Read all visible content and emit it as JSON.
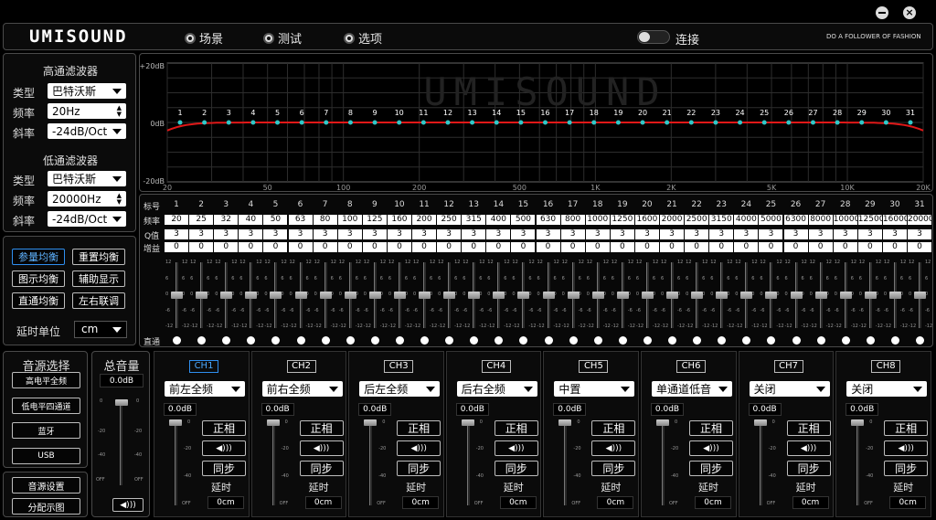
{
  "app": {
    "logo": "UMISOUND",
    "tagline": "DO A FOLLOWER OF FASHION",
    "connect": "连接"
  },
  "menu": [
    "场景",
    "测试",
    "选项"
  ],
  "hpf": {
    "title": "高通滤波器",
    "type_label": "类型",
    "type": "巴特沃斯",
    "freq_label": "频率",
    "freq": "20Hz",
    "slope_label": "斜率",
    "slope": "-24dB/Oct"
  },
  "lpf": {
    "title": "低通滤波器",
    "type_label": "类型",
    "type": "巴特沃斯",
    "freq_label": "频率",
    "freq": "20000Hz",
    "slope_label": "斜率",
    "slope": "-24dB/Oct"
  },
  "eq_buttons": [
    "参量均衡",
    "重置均衡",
    "图示均衡",
    "辅助显示",
    "直通均衡",
    "左右联调"
  ],
  "delay_unit": {
    "label": "延时单位",
    "value": "cm"
  },
  "graph": {
    "y_labels": [
      "+20dB",
      "0dB",
      "-20dB"
    ],
    "x_labels": [
      "20",
      "50",
      "100",
      "200",
      "500",
      "1K",
      "2K",
      "5K",
      "10K",
      "20K"
    ],
    "watermark": "UMISOUND"
  },
  "eq_table": {
    "row_labels": [
      "标号",
      "频率",
      "Q值",
      "增益"
    ],
    "freqs": [
      "20",
      "25",
      "32",
      "40",
      "50",
      "63",
      "80",
      "100",
      "125",
      "160",
      "200",
      "250",
      "315",
      "400",
      "500",
      "630",
      "800",
      "1000",
      "1250",
      "1600",
      "2000",
      "2500",
      "3150",
      "4000",
      "5000",
      "6300",
      "8000",
      "10000",
      "12500",
      "16000",
      "20000"
    ],
    "q": "3",
    "gain": "0",
    "scale": [
      "12",
      "6",
      "0",
      "-6",
      "-12"
    ],
    "bypass": "直通"
  },
  "source": {
    "title": "音源选择",
    "items": [
      "高电平全频",
      "低电平四通道",
      "蓝牙",
      "USB"
    ],
    "settings": "音源设置",
    "dist": "分配示图"
  },
  "master": {
    "title": "总音量",
    "value": "0.0dB",
    "scale": [
      "0",
      "-20",
      "-40",
      "OFF"
    ],
    "scale_r": [
      "0",
      "-20",
      "-40",
      "OFF"
    ]
  },
  "channels": [
    {
      "name": "CH1",
      "type": "前左全频",
      "active": true
    },
    {
      "name": "CH2",
      "type": "前右全频"
    },
    {
      "name": "CH3",
      "type": "后左全频"
    },
    {
      "name": "CH4",
      "type": "后右全频"
    },
    {
      "name": "CH5",
      "type": "中置"
    },
    {
      "name": "CH6",
      "type": "单通道低音"
    },
    {
      "name": "CH7",
      "type": "关闭"
    },
    {
      "name": "CH8",
      "type": "关闭"
    }
  ],
  "ch_common": {
    "vol": "0.0dB",
    "phase": "正相",
    "sync": "同步",
    "delay_label": "延时",
    "delay": "0cm",
    "scale": [
      "0",
      "-20",
      "-40",
      "OFF"
    ]
  }
}
